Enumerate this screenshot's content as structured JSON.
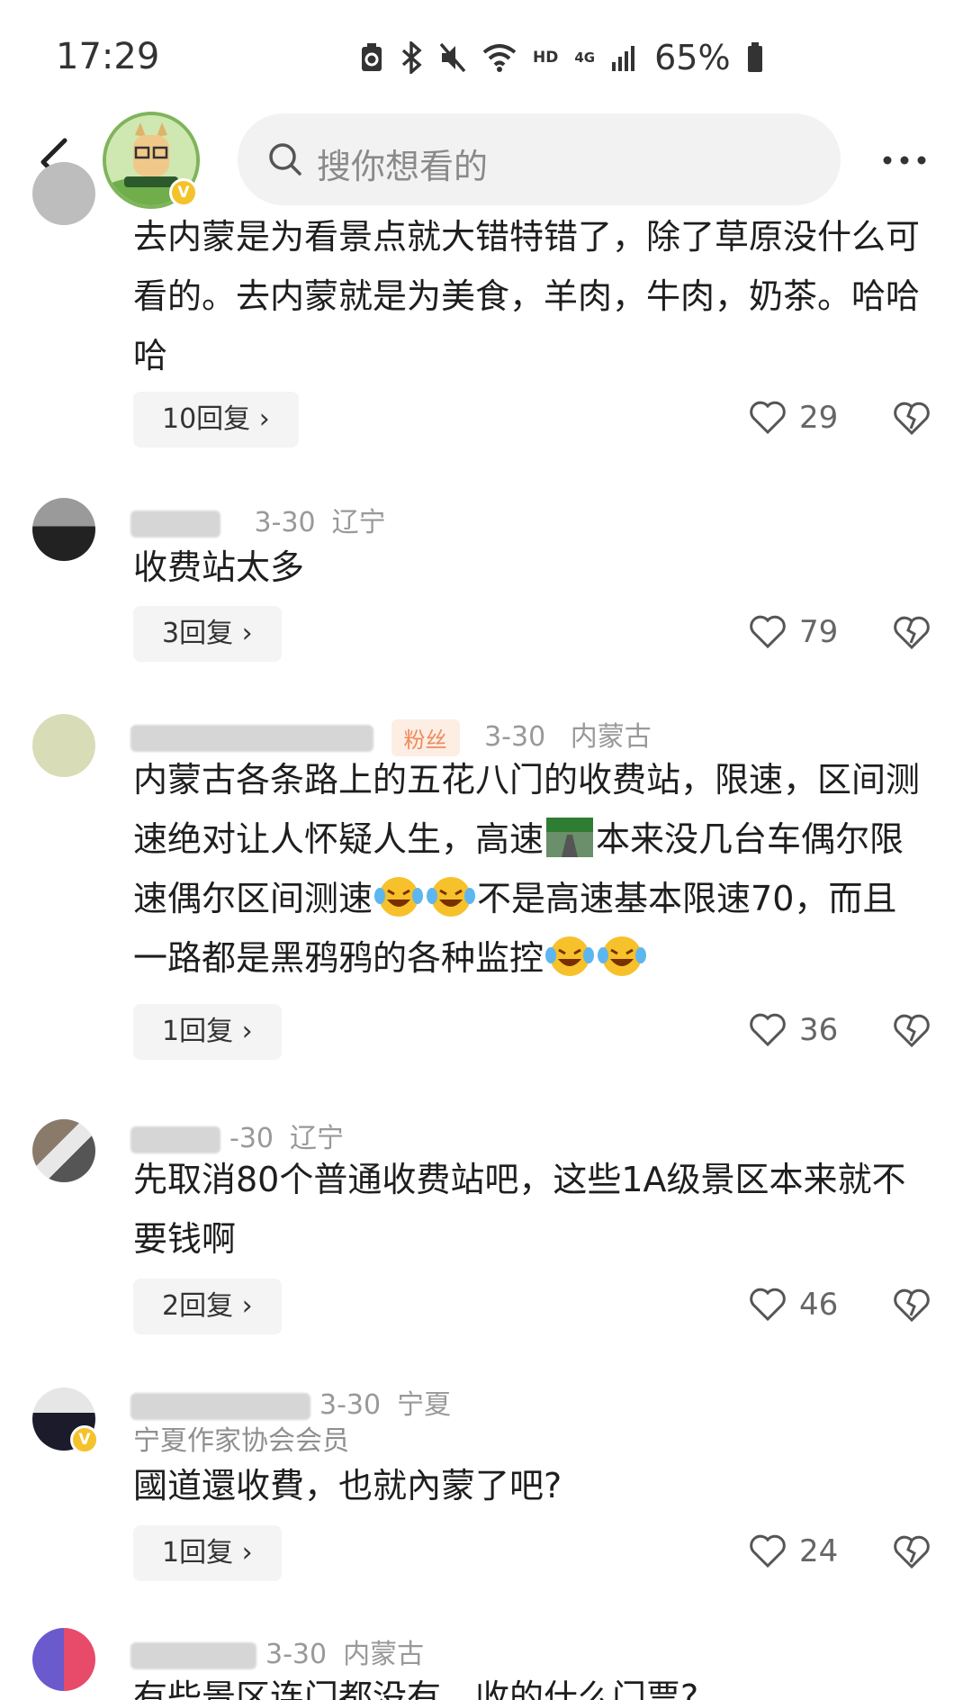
{
  "status_bar": {
    "time": "17:29",
    "network_hd": "HD",
    "network_gen": "4G",
    "battery": "65%"
  },
  "header": {
    "search_placeholder": "搜你想看的"
  },
  "comments": [
    {
      "text": "去内蒙是为看景点就大错特错了，除了草原没什么可看的。去内蒙就是为美食，羊肉，牛肉，奶茶。哈哈哈",
      "replies": "10回复 ›",
      "likes": "29"
    },
    {
      "date": "3-30",
      "location": "辽宁",
      "text": "收费站太多",
      "replies": "3回复 ›",
      "likes": "79"
    },
    {
      "badge": "粉丝",
      "date": "3-30",
      "location": "内蒙古",
      "text_part1": "内蒙古各条路上的五花八门的收费站，限速，区间测速绝对让人怀疑人生，高速",
      "text_part2": "本来没几台车偶尔限速偶尔区间测速",
      "text_part3": "不是高速基本限速70，而且一路都是黑鸦鸦的各种监控",
      "replies": "1回复 ›",
      "likes": "36"
    },
    {
      "date": "-30",
      "location": "辽宁",
      "text": "先取消80个普通收费站吧，这些1A级景区本来就不要钱啊",
      "replies": "2回复 ›",
      "likes": "46"
    },
    {
      "date": "3-30",
      "location": "宁夏",
      "title": "宁夏作家协会会员",
      "text": "國道還收費，也就內蒙了吧?",
      "replies": "1回复 ›",
      "likes": "24"
    },
    {
      "date": "3-30",
      "location": "内蒙古",
      "text": "有些景区连门都没有，收的什么门票?"
    }
  ],
  "colors": {
    "accent_fan": "#f08a5d",
    "verified": "#f4c22b"
  },
  "icons": [
    "back-arrow-icon",
    "search-icon",
    "more-icon",
    "heart-icon",
    "broken-heart-icon",
    "laugh-cry-emoji",
    "highway-emoji"
  ]
}
